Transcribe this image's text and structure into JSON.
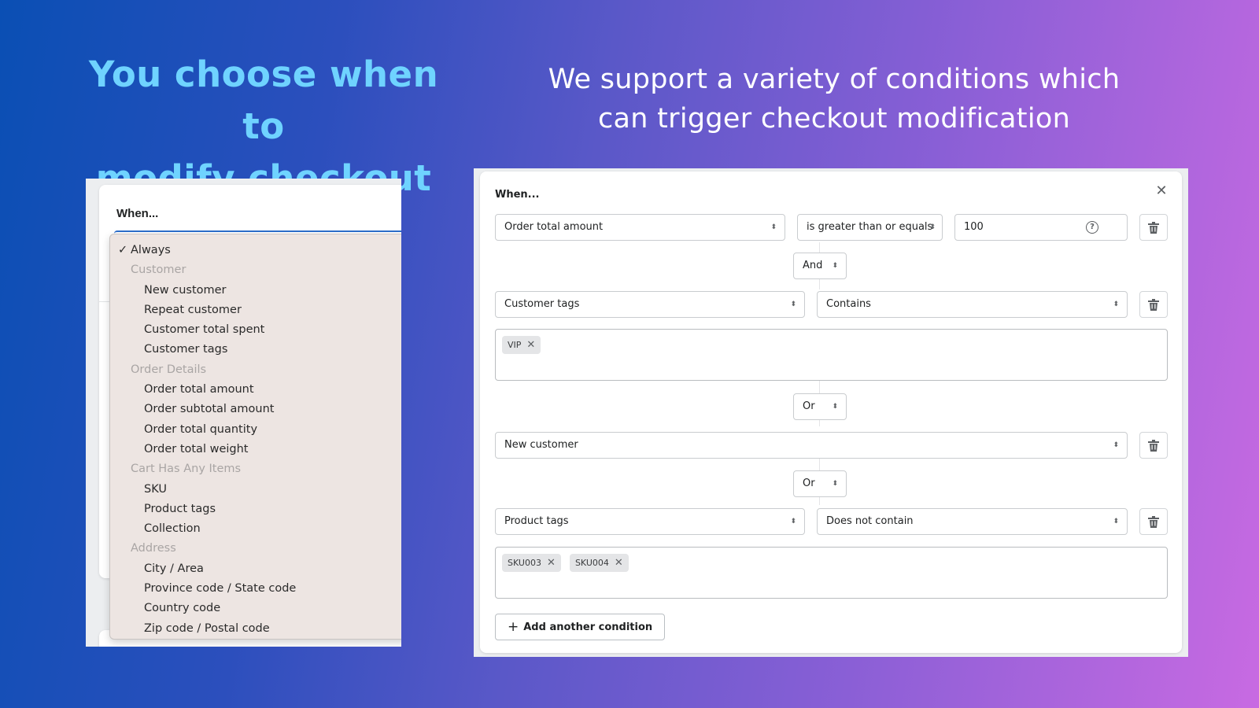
{
  "headlines": {
    "left_line1": "You choose when to",
    "left_line2": "modify checkout",
    "right_line1": "We support a variety of conditions which",
    "right_line2": "can trigger checkout modification"
  },
  "colors": {
    "left_headline": "#6fd3ff",
    "right_headline": "#ffffff",
    "gradient_start": "#0a4fb4",
    "gradient_end": "#c86ae2"
  },
  "left_panel": {
    "label": "When...",
    "dropdown": {
      "selected": "Always",
      "check_icon": "✓",
      "items": [
        {
          "type": "selected",
          "label": "Always"
        },
        {
          "type": "group",
          "label": "Customer"
        },
        {
          "type": "option",
          "label": "New customer"
        },
        {
          "type": "option",
          "label": "Repeat customer"
        },
        {
          "type": "option",
          "label": "Customer total spent"
        },
        {
          "type": "option",
          "label": "Customer tags"
        },
        {
          "type": "group",
          "label": "Order Details"
        },
        {
          "type": "option",
          "label": "Order total amount"
        },
        {
          "type": "option",
          "label": "Order subtotal amount"
        },
        {
          "type": "option",
          "label": "Order total quantity"
        },
        {
          "type": "option",
          "label": "Order total weight"
        },
        {
          "type": "group",
          "label": "Cart Has Any Items"
        },
        {
          "type": "option",
          "label": "SKU"
        },
        {
          "type": "option",
          "label": "Product tags"
        },
        {
          "type": "option",
          "label": "Collection"
        },
        {
          "type": "group",
          "label": "Address"
        },
        {
          "type": "option",
          "label": "City / Area"
        },
        {
          "type": "option",
          "label": "Province code / State code"
        },
        {
          "type": "option",
          "label": "Country code"
        },
        {
          "type": "option",
          "label": "Zip code / Postal code"
        }
      ]
    }
  },
  "right_panel": {
    "label": "When...",
    "close_icon": "✕",
    "conditions": [
      {
        "field": "Order total amount",
        "operator": "is greater than or equals",
        "value": "100",
        "help_icon": "?"
      },
      {
        "field": "Customer tags",
        "operator": "Contains",
        "tags": [
          "VIP"
        ]
      },
      {
        "field": "New customer"
      },
      {
        "field": "Product tags",
        "operator": "Does not contain",
        "tags": [
          "SKU003",
          "SKU004"
        ]
      }
    ],
    "connectors": [
      "And",
      "Or",
      "Or"
    ],
    "select_arrows": "⬍",
    "tag_remove_icon": "✕",
    "add_button": {
      "icon": "+",
      "label": "Add another condition"
    }
  }
}
